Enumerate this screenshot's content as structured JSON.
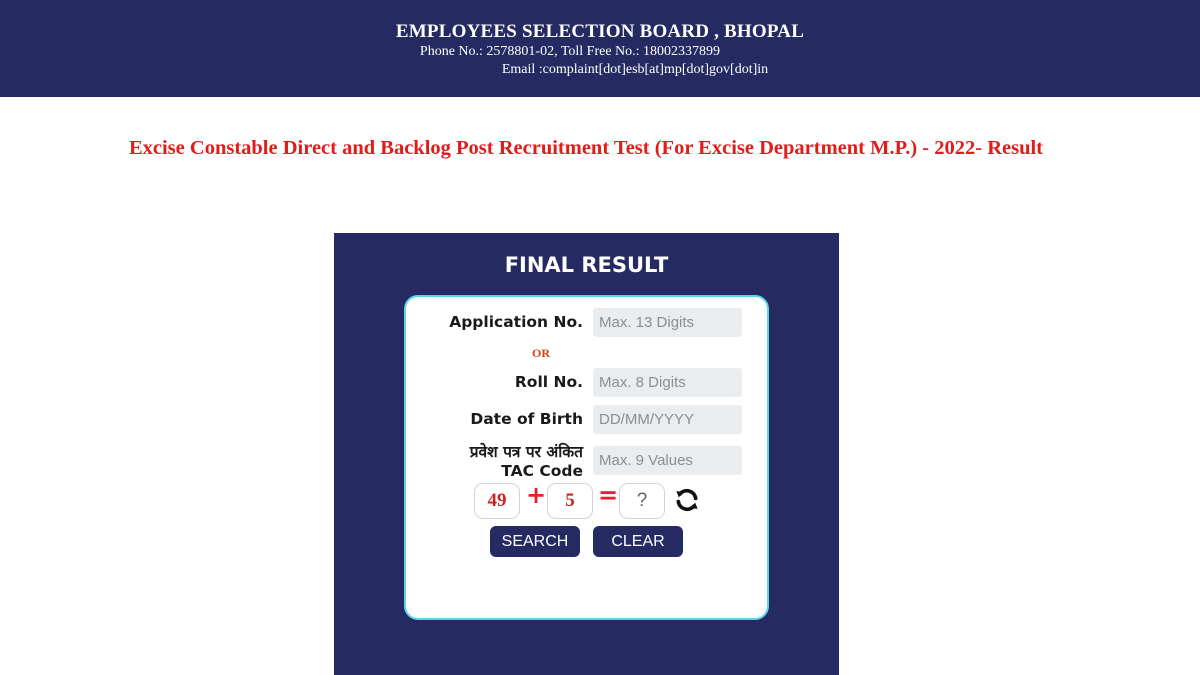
{
  "header": {
    "org_name": "EMPLOYEES SELECTION BOARD , BHOPAL",
    "phone_line": "Phone No.: 2578801-02, Toll Free No.: 18002337899",
    "email_line": "Email :complaint[dot]esb[at]mp[dot]gov[dot]in"
  },
  "page_title": "Excise Constable Direct and Backlog Post Recruitment Test (For Excise Department M.P.) - 2022- Result",
  "panel": {
    "title": "FINAL RESULT",
    "form": {
      "application_label": "Application No.",
      "application_placeholder": "Max. 13 Digits",
      "or_text": "OR",
      "roll_label": "Roll No.",
      "roll_placeholder": "Max. 8 Digits",
      "dob_label": "Date of Birth",
      "dob_placeholder": "DD/MM/YYYY",
      "tac_label_line1": "प्रवेश पत्र पर अंकित",
      "tac_label_line2": "TAC Code",
      "tac_placeholder": "Max. 9 Values"
    },
    "captcha": {
      "operand1": "49",
      "operator": "+",
      "operand2": "5",
      "equals": "=",
      "answer_placeholder": "?",
      "refresh_icon": "refresh-icon"
    },
    "buttons": {
      "search": "SEARCH",
      "clear": "CLEAR"
    }
  },
  "colors": {
    "navy": "#262a62",
    "title_red": "#e21b1b",
    "card_border": "#5ad6e8",
    "input_bg": "#e9edf0"
  }
}
